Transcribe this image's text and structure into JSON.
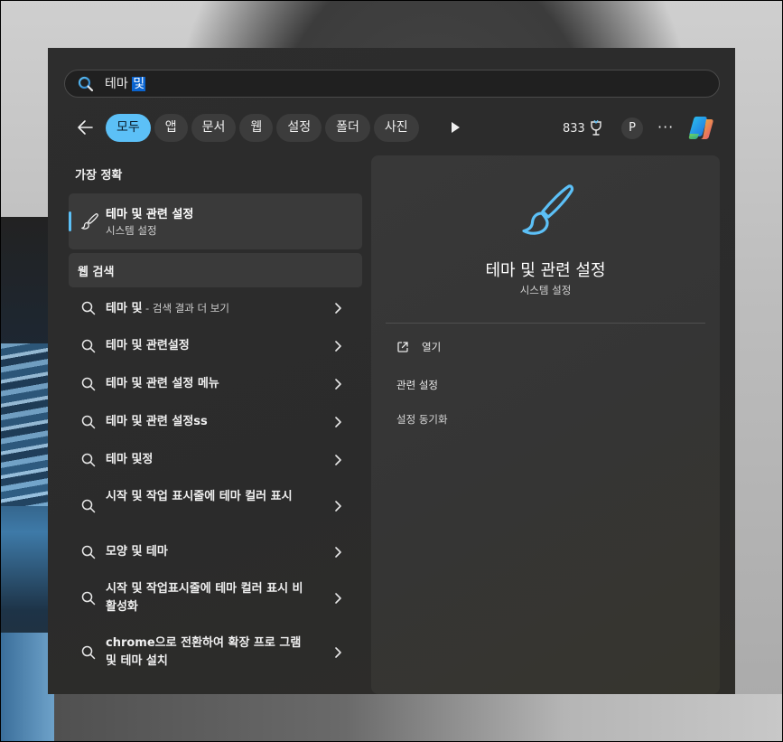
{
  "search": {
    "query_plain": "테마 ",
    "query_selected": "및"
  },
  "filters": [
    {
      "label": "모두",
      "active": true
    },
    {
      "label": "앱",
      "active": false
    },
    {
      "label": "문서",
      "active": false
    },
    {
      "label": "웹",
      "active": false
    },
    {
      "label": "설정",
      "active": false
    },
    {
      "label": "폴더",
      "active": false
    },
    {
      "label": "사진",
      "active": false
    }
  ],
  "toolbar": {
    "points": "833",
    "avatar_initial": "P",
    "more": "···"
  },
  "best_match": {
    "section_label": "가장 정확",
    "title": "테마 및 관련 설정",
    "subtitle": "시스템 설정",
    "icon": "paintbrush-icon"
  },
  "web_search": {
    "section_label": "웹 검색",
    "results": [
      {
        "text": "테마 및",
        "extra": " - 검색 결과 더 보기"
      },
      {
        "text": "테마 및 관련설정",
        "extra": ""
      },
      {
        "text": "테마 및 관련 설정 메뉴",
        "extra": ""
      },
      {
        "text": "테마 및 관련 설정ss",
        "extra": ""
      },
      {
        "text": "테마 및정",
        "extra": ""
      },
      {
        "text": "시작 및 작업 표시줄에 테마 컬러 표시",
        "extra": ""
      },
      {
        "text": "모양 및 테마",
        "extra": ""
      },
      {
        "text": "시작 및 작업표시줄에 테마 컬러 표시 비활성화",
        "extra": ""
      },
      {
        "text": "chrome으로 전환하여 확장 프로 그램 및 테마 설치",
        "extra": ""
      }
    ]
  },
  "detail": {
    "title": "테마 및 관련 설정",
    "subtitle": "시스템 설정",
    "open_label": "열기",
    "related_label": "관련 설정",
    "sync_label": "설정 동기화"
  },
  "colors": {
    "accent": "#5cc0f7",
    "selection": "#0a64d0"
  }
}
